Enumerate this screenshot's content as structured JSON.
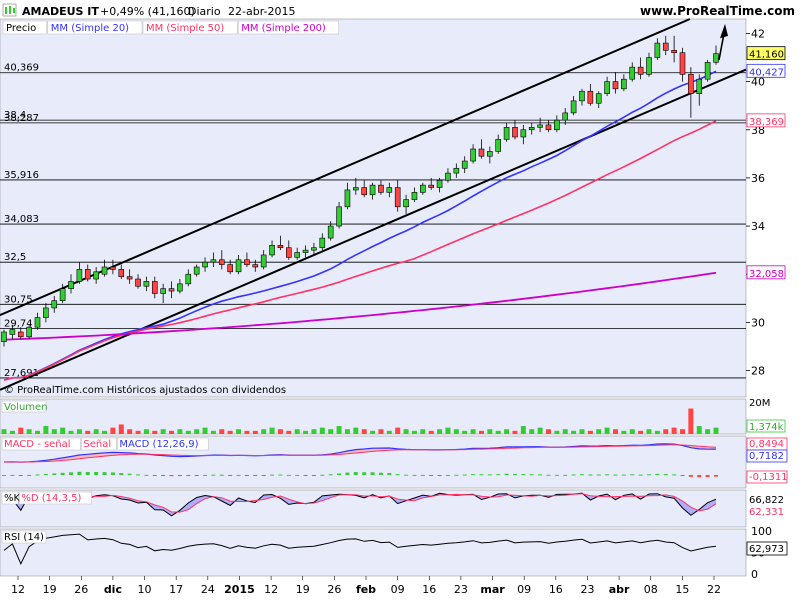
{
  "header": {
    "symbol": "AMADEUS IT",
    "change": "+0,49% (41,160)",
    "period": "Diario",
    "date": "22-abr-2015",
    "brand": "www.ProRealTime.com",
    "copyright": "© ProRealTime.com  Históricos ajustados con dividendos"
  },
  "legend": [
    {
      "label": "Precio",
      "color": "#000000"
    },
    {
      "label": "MM (Simple 20)",
      "color": "#3333ff"
    },
    {
      "label": "MM (Simple 50)",
      "color": "#ff3366"
    },
    {
      "label": "MM (Simple 200)",
      "color": "#cc00cc"
    }
  ],
  "colors": {
    "bull": "#33cc33",
    "bear": "#ff4444",
    "panel_bg": "#e8ecfa",
    "axis_bg": "#ffffff"
  },
  "chart_data": [
    {
      "type": "candlestick",
      "panel": "price",
      "ylim": [
        26.9,
        42.6
      ],
      "yticks": [
        28,
        30,
        32,
        34,
        36,
        38,
        40,
        42
      ],
      "x_labels": [
        "12",
        "19",
        "26",
        "dic",
        "10",
        "17",
        "24",
        "2015",
        "12",
        "19",
        "26",
        "feb",
        "09",
        "16",
        "23",
        "mar",
        "09",
        "16",
        "23",
        "abr",
        "08",
        "15",
        "22"
      ],
      "horizontal_levels": [
        {
          "value": 27.691,
          "label": "27,691"
        },
        {
          "value": 29.74,
          "label": "29,74"
        },
        {
          "value": 30.75,
          "label": "30,75"
        },
        {
          "value": 32.5,
          "label": "32,5"
        },
        {
          "value": 34.083,
          "label": "34,083"
        },
        {
          "value": 35.916,
          "label": "35,916"
        },
        {
          "value": 38.4,
          "label": "38,4"
        },
        {
          "value": 38.287,
          "label": "38,287"
        },
        {
          "value": 40.369,
          "label": "40,369"
        }
      ],
      "value_badges": [
        {
          "value": 41.16,
          "label": "41,160",
          "bg": "#ffff66",
          "fg": "#000000"
        },
        {
          "value": 40.427,
          "label": "40,427",
          "bg": "#ffffff",
          "fg": "#3333ff"
        },
        {
          "value": 38.369,
          "label": "38,369",
          "bg": "#ffffff",
          "fg": "#ff3366"
        },
        {
          "value": 32.058,
          "label": "32,058",
          "bg": "#ffffff",
          "fg": "#cc00cc"
        }
      ],
      "candles": [
        [
          29.2,
          29.7,
          29.0,
          29.6
        ],
        [
          29.5,
          29.9,
          29.3,
          29.7
        ],
        [
          29.6,
          29.8,
          29.3,
          29.4
        ],
        [
          29.4,
          29.9,
          29.3,
          29.8
        ],
        [
          29.8,
          30.4,
          29.7,
          30.2
        ],
        [
          30.2,
          30.8,
          30.0,
          30.6
        ],
        [
          30.6,
          31.1,
          30.4,
          30.9
        ],
        [
          30.9,
          31.6,
          30.8,
          31.4
        ],
        [
          31.4,
          32.0,
          31.2,
          31.7
        ],
        [
          31.7,
          32.5,
          31.6,
          32.2
        ],
        [
          32.2,
          32.4,
          31.7,
          31.8
        ],
        [
          31.8,
          32.3,
          31.6,
          32.1
        ],
        [
          32.0,
          32.6,
          31.9,
          32.3
        ],
        [
          32.3,
          32.6,
          32.0,
          32.2
        ],
        [
          32.2,
          32.4,
          31.8,
          31.9
        ],
        [
          31.9,
          32.2,
          31.6,
          31.8
        ],
        [
          31.8,
          32.0,
          31.4,
          31.5
        ],
        [
          31.5,
          31.9,
          31.3,
          31.7
        ],
        [
          31.7,
          31.9,
          31.0,
          31.2
        ],
        [
          31.2,
          31.6,
          30.8,
          31.4
        ],
        [
          31.4,
          31.7,
          31.0,
          31.3
        ],
        [
          31.3,
          31.8,
          31.2,
          31.6
        ],
        [
          31.6,
          32.2,
          31.5,
          32.0
        ],
        [
          32.0,
          32.4,
          31.9,
          32.3
        ],
        [
          32.3,
          32.7,
          32.1,
          32.5
        ],
        [
          32.5,
          32.9,
          32.3,
          32.6
        ],
        [
          32.6,
          33.0,
          32.2,
          32.4
        ],
        [
          32.4,
          32.6,
          32.0,
          32.1
        ],
        [
          32.1,
          32.8,
          32.0,
          32.6
        ],
        [
          32.6,
          32.9,
          32.3,
          32.4
        ],
        [
          32.4,
          32.6,
          32.1,
          32.3
        ],
        [
          32.3,
          33.0,
          32.2,
          32.8
        ],
        [
          32.8,
          33.4,
          32.7,
          33.2
        ],
        [
          33.2,
          33.6,
          33.0,
          33.1
        ],
        [
          33.1,
          33.4,
          32.6,
          32.7
        ],
        [
          32.7,
          33.1,
          32.6,
          32.9
        ],
        [
          32.9,
          33.2,
          32.7,
          33.0
        ],
        [
          33.0,
          33.3,
          32.8,
          33.1
        ],
        [
          33.1,
          33.7,
          33.0,
          33.5
        ],
        [
          33.5,
          34.2,
          33.4,
          34.0
        ],
        [
          34.0,
          35.0,
          33.9,
          34.8
        ],
        [
          34.8,
          35.8,
          34.7,
          35.5
        ],
        [
          35.5,
          36.0,
          35.3,
          35.6
        ],
        [
          35.6,
          35.9,
          35.2,
          35.3
        ],
        [
          35.3,
          35.8,
          35.1,
          35.7
        ],
        [
          35.7,
          35.9,
          35.3,
          35.4
        ],
        [
          35.4,
          35.8,
          35.2,
          35.6
        ],
        [
          35.6,
          35.9,
          34.6,
          34.8
        ],
        [
          34.8,
          35.3,
          34.5,
          35.1
        ],
        [
          35.1,
          35.6,
          35.0,
          35.4
        ],
        [
          35.4,
          35.8,
          35.3,
          35.7
        ],
        [
          35.7,
          36.0,
          35.5,
          35.6
        ],
        [
          35.6,
          36.0,
          35.4,
          35.9
        ],
        [
          35.9,
          36.4,
          35.8,
          36.2
        ],
        [
          36.2,
          36.6,
          36.0,
          36.4
        ],
        [
          36.4,
          36.9,
          36.2,
          36.7
        ],
        [
          36.7,
          37.4,
          36.6,
          37.2
        ],
        [
          37.2,
          37.6,
          36.8,
          36.9
        ],
        [
          36.9,
          37.3,
          36.6,
          37.1
        ],
        [
          37.1,
          37.8,
          37.0,
          37.6
        ],
        [
          37.6,
          38.3,
          37.5,
          38.1
        ],
        [
          38.1,
          38.4,
          37.6,
          37.7
        ],
        [
          37.7,
          38.2,
          37.4,
          38.0
        ],
        [
          38.0,
          38.3,
          37.8,
          38.1
        ],
        [
          38.1,
          38.5,
          37.9,
          38.2
        ],
        [
          38.2,
          38.4,
          37.9,
          38.0
        ],
        [
          38.0,
          38.6,
          37.9,
          38.4
        ],
        [
          38.4,
          38.9,
          38.2,
          38.7
        ],
        [
          38.7,
          39.4,
          38.6,
          39.2
        ],
        [
          39.2,
          39.7,
          39.0,
          39.6
        ],
        [
          39.6,
          39.9,
          39.0,
          39.1
        ],
        [
          39.1,
          39.6,
          38.9,
          39.5
        ],
        [
          39.5,
          40.2,
          39.4,
          40.0
        ],
        [
          40.0,
          40.4,
          39.5,
          39.7
        ],
        [
          39.7,
          40.3,
          39.6,
          40.1
        ],
        [
          40.1,
          40.8,
          40.0,
          40.6
        ],
        [
          40.6,
          41.0,
          40.1,
          40.3
        ],
        [
          40.3,
          41.2,
          40.2,
          41.0
        ],
        [
          41.0,
          41.8,
          40.9,
          41.6
        ],
        [
          41.6,
          41.9,
          41.1,
          41.3
        ],
        [
          41.3,
          41.9,
          40.8,
          41.2
        ],
        [
          41.2,
          41.4,
          40.0,
          40.3
        ],
        [
          40.3,
          40.6,
          38.5,
          39.5
        ],
        [
          39.5,
          40.3,
          39.0,
          40.1
        ],
        [
          40.1,
          40.9,
          40.0,
          40.8
        ],
        [
          40.8,
          41.5,
          40.7,
          41.16
        ]
      ],
      "ma20_start": 27.6,
      "ma20_end": 40.43,
      "ma50_start": 27.6,
      "ma50_end": 38.37,
      "ma200_start": 29.28,
      "ma200_end": 32.06,
      "annotations": "upward trend channel lines and up arrow"
    },
    {
      "type": "bar",
      "panel": "volume",
      "label": "Volumen",
      "yticks": [
        {
          "value": 20,
          "label": "20M"
        }
      ],
      "badge": "1,374k",
      "ylim": [
        0,
        22
      ],
      "values": [
        3,
        2,
        4,
        3,
        2,
        5,
        3,
        4,
        2,
        3,
        2,
        3,
        2,
        4,
        6,
        3,
        2,
        3,
        2,
        3,
        2,
        3,
        2,
        3,
        4,
        2,
        3,
        2,
        3,
        2,
        2,
        3,
        4,
        3,
        2,
        3,
        2,
        3,
        4,
        3,
        5,
        3,
        4,
        3,
        2,
        3,
        2,
        4,
        3,
        2,
        3,
        2,
        3,
        4,
        3,
        2,
        3,
        2,
        3,
        2,
        3,
        2,
        5,
        3,
        4,
        3,
        2,
        3,
        2,
        3,
        2,
        3,
        4,
        3,
        2,
        3,
        2,
        3,
        2,
        3,
        4,
        3,
        16,
        5,
        3,
        4,
        3
      ]
    },
    {
      "type": "macd",
      "panel": "macd",
      "labels": [
        "MACD - señal",
        "Señal",
        "MACD (12,26,9)"
      ],
      "badges": [
        {
          "label": "0,8494",
          "fg": "#ff3366"
        },
        {
          "label": "0,7182",
          "fg": "#3333ff"
        },
        {
          "label": "-0,1311",
          "fg": "#ff3366"
        }
      ]
    },
    {
      "type": "stochastic",
      "panel": "stoch",
      "labels": [
        "%K",
        "%D (14,3,5)"
      ],
      "badges": [
        {
          "label": "66,822",
          "fg": "#000000"
        },
        {
          "label": "62,331",
          "fg": "#ff3366"
        }
      ]
    },
    {
      "type": "line",
      "panel": "rsi",
      "label": "RSI (14)",
      "yticks": [
        {
          "value": 100,
          "label": "100"
        },
        {
          "value": 50,
          "label": "50"
        },
        {
          "value": 0,
          "label": "0"
        }
      ],
      "badge": "62,973"
    }
  ]
}
